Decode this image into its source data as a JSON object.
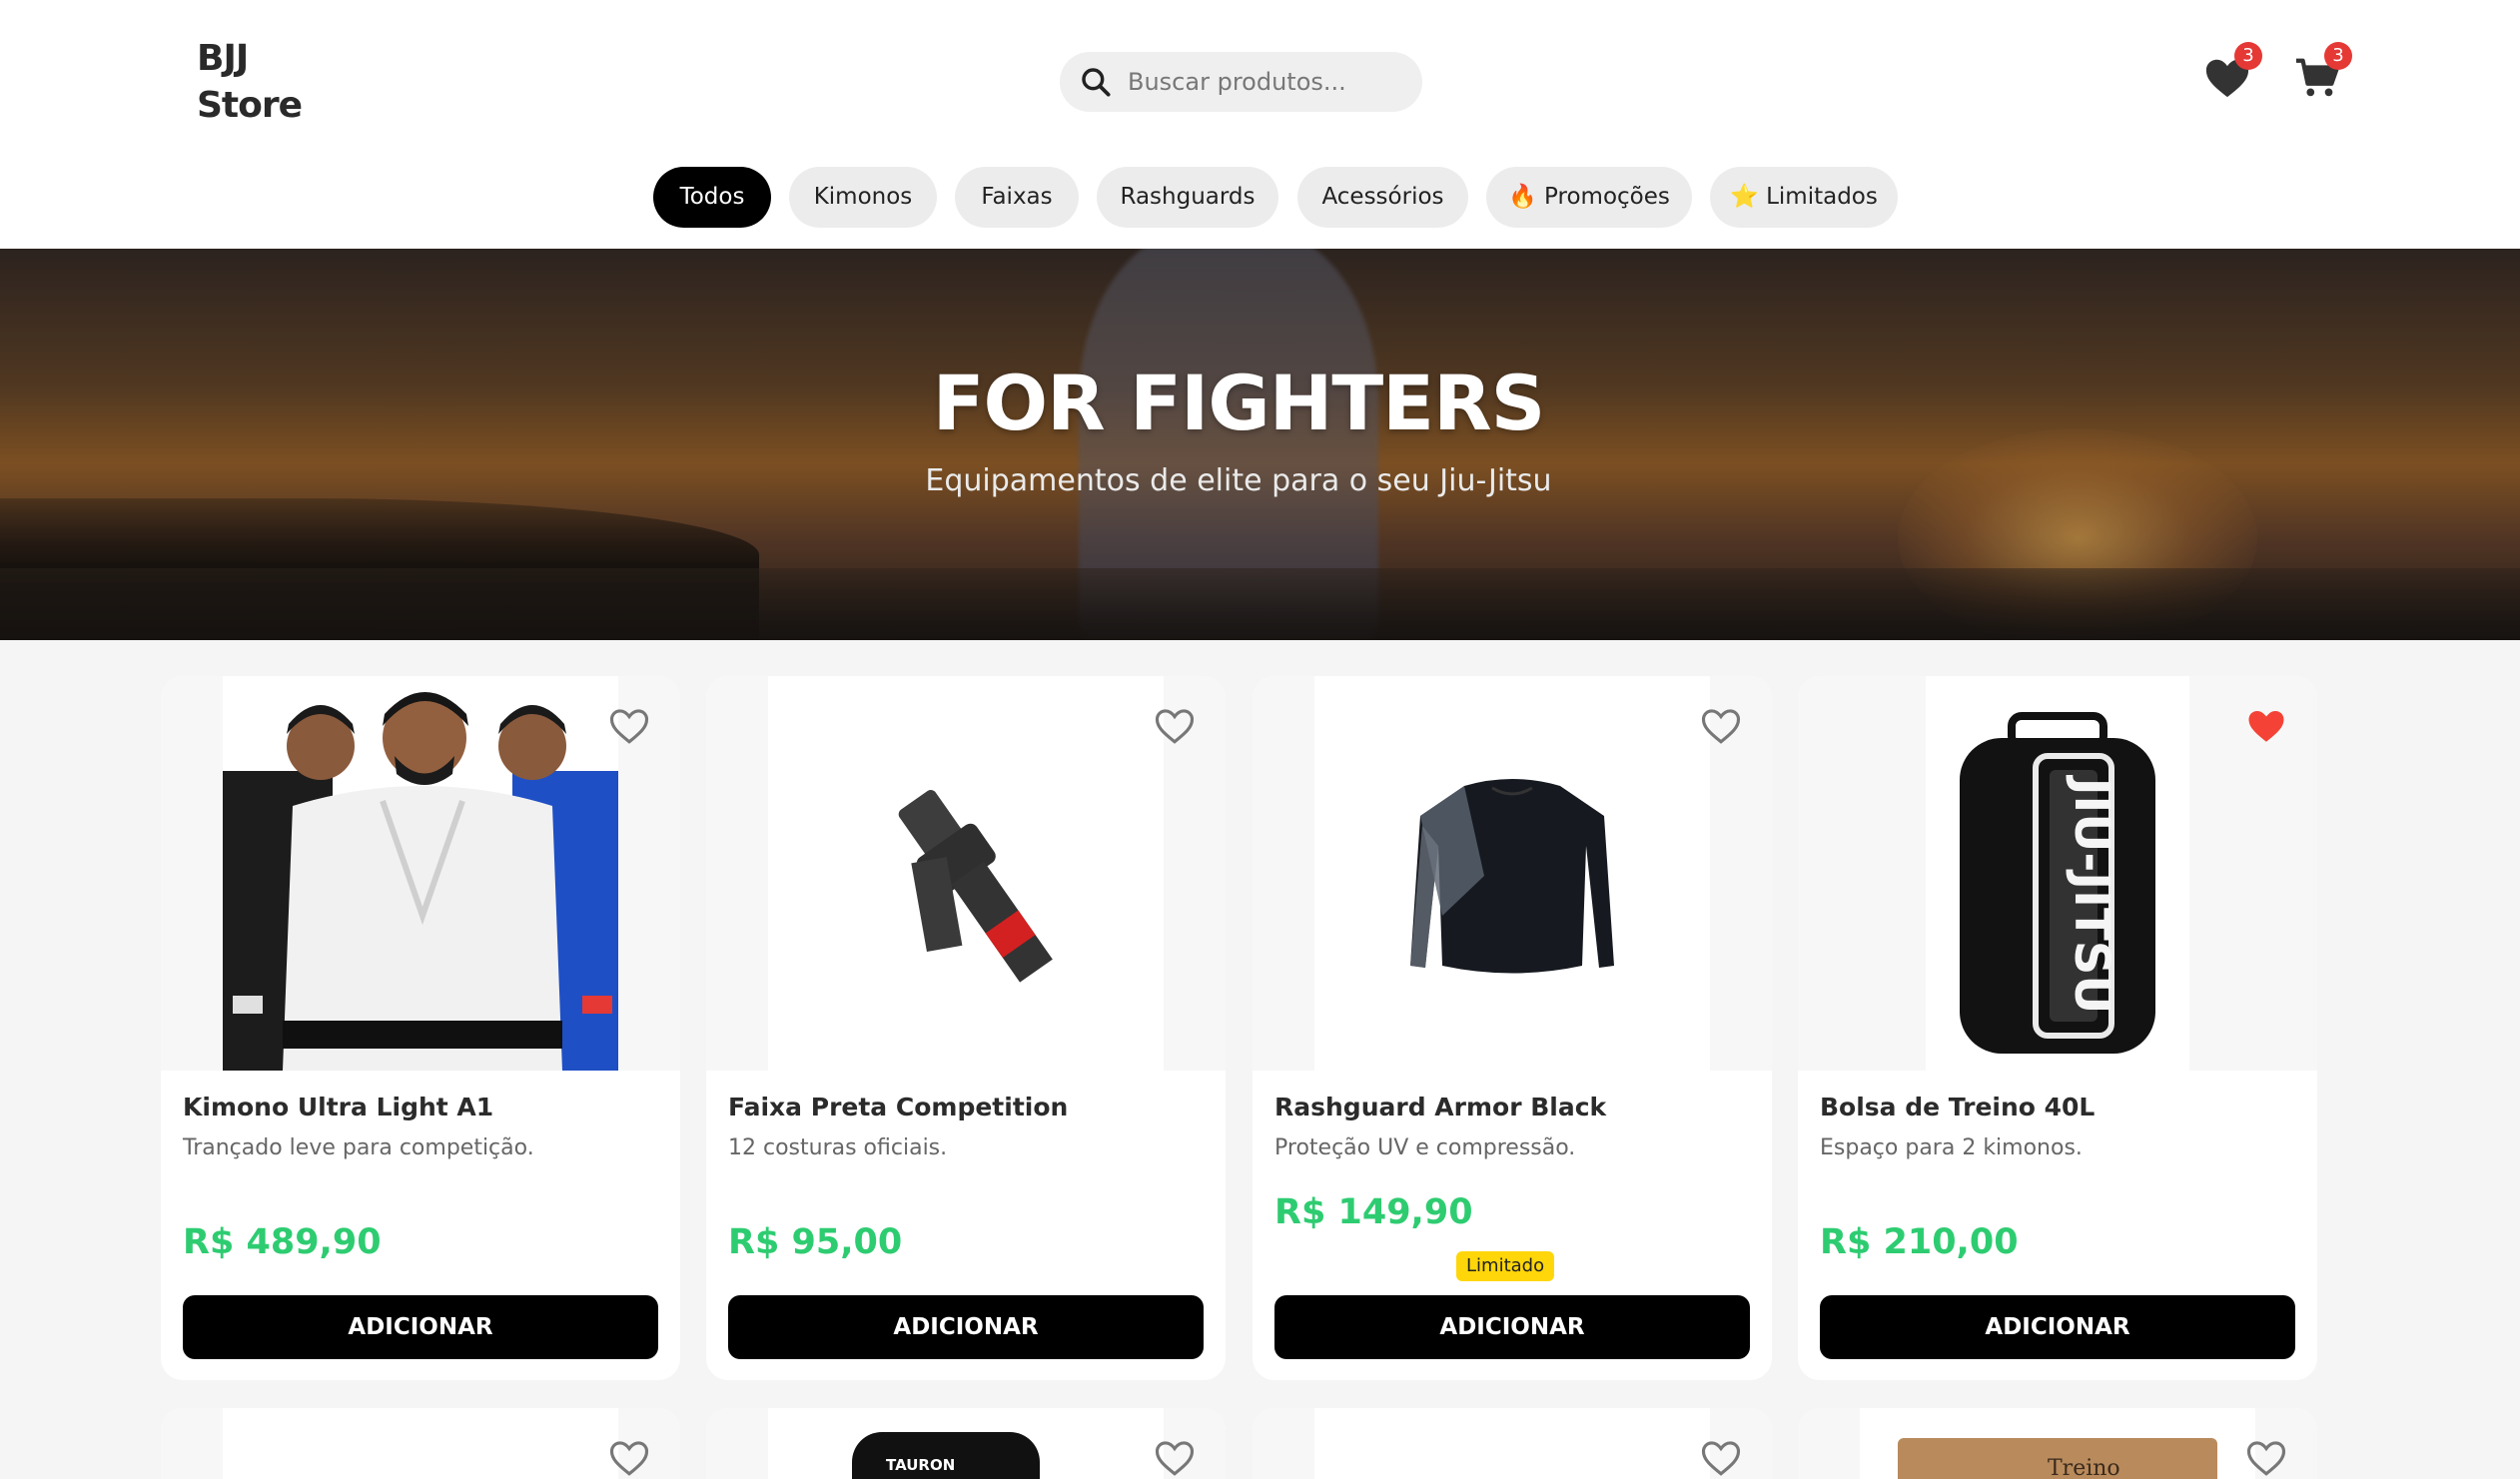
{
  "brand": {
    "line1": "BJJ",
    "line2": "Store"
  },
  "search": {
    "placeholder": "Buscar produtos..."
  },
  "header": {
    "wishlist_count": "3",
    "cart_count": "3"
  },
  "categories": [
    {
      "label": "Todos",
      "active": true
    },
    {
      "label": "Kimonos"
    },
    {
      "label": "Faixas"
    },
    {
      "label": "Rashguards"
    },
    {
      "label": "Acessórios"
    },
    {
      "label": "🔥 Promoções"
    },
    {
      "label": "⭐ Limitados"
    }
  ],
  "hero": {
    "title": "FOR FIGHTERS",
    "subtitle": "Equipamentos de elite para o seu Jiu-Jitsu"
  },
  "products": [
    {
      "name": "Kimono Ultra Light A1",
      "description": "Trançado leve para competição.",
      "price": "R$ 489,90",
      "button": "ADICIONAR",
      "favorited": false
    },
    {
      "name": "Faixa Preta Competition",
      "description": "12 costuras oficiais.",
      "price": "R$ 95,00",
      "button": "ADICIONAR",
      "favorited": false
    },
    {
      "name": "Rashguard Armor Black",
      "description": "Proteção UV e compressão.",
      "price": "R$ 149,90",
      "badge": "Limitado",
      "button": "ADICIONAR",
      "favorited": false
    },
    {
      "name": "Bolsa de Treino 40L",
      "description": "Espaço para 2 kimonos.",
      "price": "R$ 210,00",
      "button": "ADICIONAR",
      "favorited": true
    }
  ],
  "next_row": {
    "brand_label": "TAURON",
    "bag_text": "Treino"
  },
  "colors": {
    "price": "#2ecc71",
    "badge": "#e53935",
    "limited": "#ffd60a",
    "favorite": "#f44336"
  }
}
